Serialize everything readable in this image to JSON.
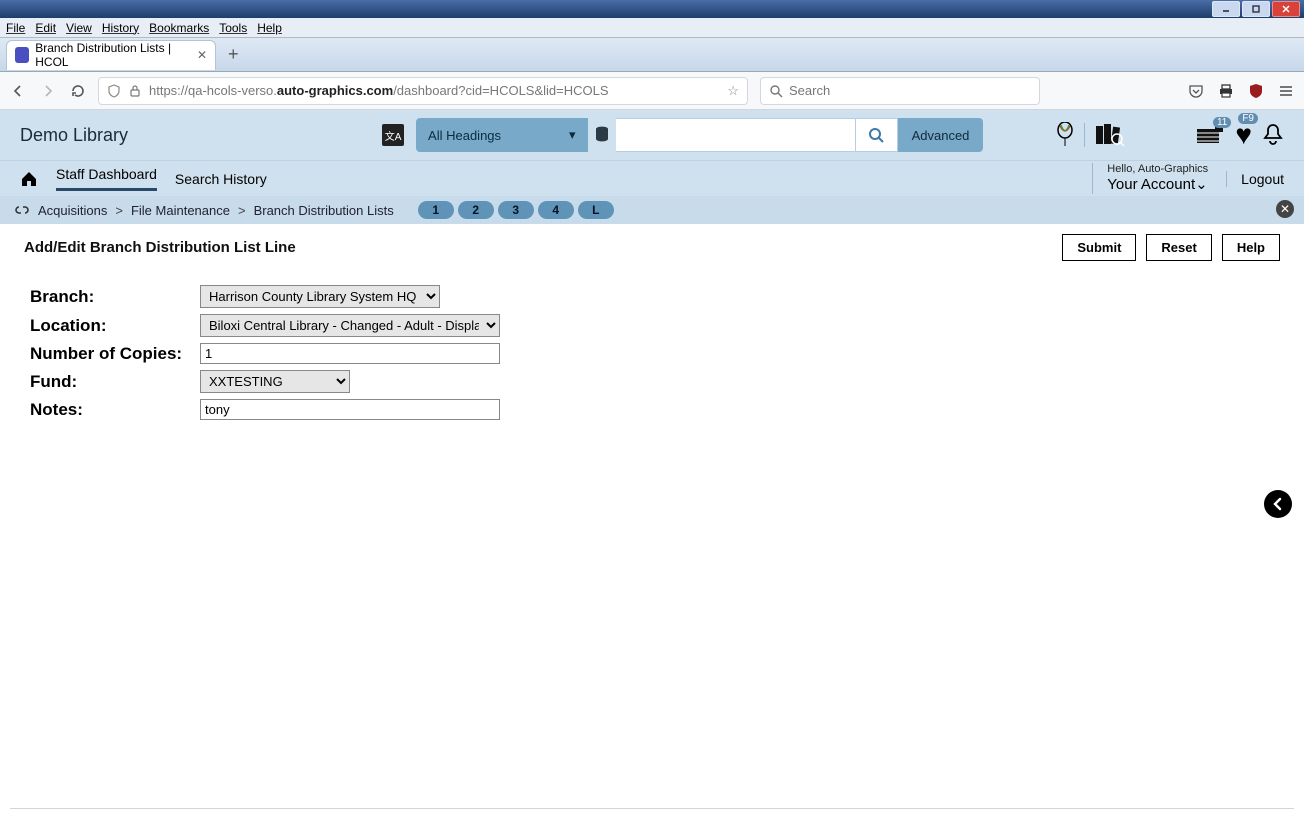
{
  "os": {
    "menus": [
      "File",
      "Edit",
      "View",
      "History",
      "Bookmarks",
      "Tools",
      "Help"
    ]
  },
  "browser": {
    "tab_title": "Branch Distribution Lists | HCOL",
    "url_display_pre": "https://qa-hcols-verso.",
    "url_display_bold": "auto-graphics.com",
    "url_display_post": "/dashboard?cid=HCOLS&lid=HCOLS",
    "search_placeholder": "Search"
  },
  "header": {
    "library_name": "Demo Library",
    "search_category": "All Headings",
    "advanced_label": "Advanced",
    "cart_badge": "11",
    "heart_badge": "F9"
  },
  "nav": {
    "staff_dashboard": "Staff Dashboard",
    "search_history": "Search History",
    "hello": "Hello, Auto-Graphics",
    "account": "Your Account",
    "logout": "Logout"
  },
  "breadcrumb": {
    "items": [
      "Acquisitions",
      "File Maintenance",
      "Branch Distribution Lists"
    ],
    "pills": [
      "1",
      "2",
      "3",
      "4",
      "L"
    ]
  },
  "page": {
    "title": "Add/Edit Branch Distribution List Line",
    "submit": "Submit",
    "reset": "Reset",
    "help": "Help"
  },
  "form": {
    "branch_label": "Branch:",
    "branch_value": "Harrison County Library System HQ",
    "location_label": "Location:",
    "location_value": "Biloxi Central Library - Changed - Adult - Displa",
    "copies_label": "Number of Copies:",
    "copies_value": "1",
    "fund_label": "Fund:",
    "fund_value": "XXTESTING",
    "notes_label": "Notes:",
    "notes_value": "tony"
  }
}
